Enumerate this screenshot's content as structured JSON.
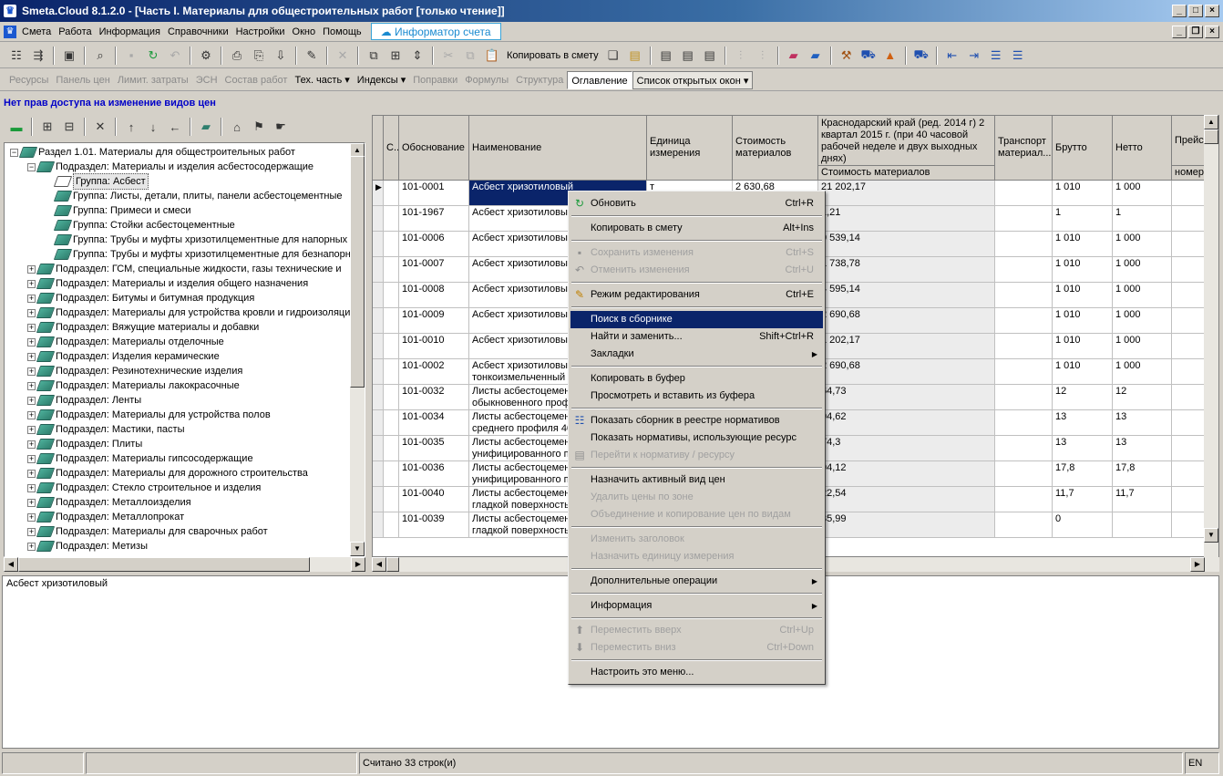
{
  "window": {
    "title": "Smeta.Cloud  8.1.2.0  - [Часть I. Материалы для общестроительных работ  [только чтение]]"
  },
  "menu": {
    "items": [
      "Смета",
      "Работа",
      "Информация",
      "Справочники",
      "Настройки",
      "Окно",
      "Помощь"
    ],
    "informator": "Информатор счета"
  },
  "toolbar1": {
    "copy_to_estimate": "Копировать в смету"
  },
  "toolbar2": {
    "items": [
      "Ресурсы",
      "Панель цен",
      "Лимит. затраты",
      "ЭСН",
      "Состав работ",
      "Тех. часть",
      "Индексы",
      "Поправки",
      "Формулы",
      "Структура",
      "Оглавление",
      "Список открытых окон"
    ]
  },
  "notice": "Нет прав доступа на изменение видов цен",
  "tree": {
    "nodes": [
      {
        "label": "Раздел 1.01. Материалы для общестроительных работ",
        "level": 0,
        "exp": "−"
      },
      {
        "label": "Подраздел: Материалы и изделия асбестосодержащие",
        "level": 1,
        "exp": "−"
      },
      {
        "label": "Группа: Асбест",
        "level": 2,
        "exp": "",
        "selected": true
      },
      {
        "label": "Группа: Листы, детали, плиты, панели асбестоцементные",
        "level": 2,
        "exp": ""
      },
      {
        "label": "Группа: Примеси и смеси",
        "level": 2,
        "exp": ""
      },
      {
        "label": "Группа: Стойки асбестоцементные",
        "level": 2,
        "exp": ""
      },
      {
        "label": "Группа: Трубы и муфты хризотилцементные для напорных",
        "level": 2,
        "exp": ""
      },
      {
        "label": "Группа: Трубы и муфты хризотилцементные для безнапорн",
        "level": 2,
        "exp": ""
      },
      {
        "label": "Подраздел: ГСМ, специальные жидкости, газы технические и",
        "level": 1,
        "exp": "+"
      },
      {
        "label": "Подраздел: Материалы и изделия общего назначения",
        "level": 1,
        "exp": "+"
      },
      {
        "label": "Подраздел: Битумы и битумная продукция",
        "level": 1,
        "exp": "+"
      },
      {
        "label": "Подраздел: Материалы для устройства кровли и гидроизоляци",
        "level": 1,
        "exp": "+"
      },
      {
        "label": "Подраздел: Вяжущие материалы и добавки",
        "level": 1,
        "exp": "+"
      },
      {
        "label": "Подраздел: Материалы отделочные",
        "level": 1,
        "exp": "+"
      },
      {
        "label": "Подраздел: Изделия керамические",
        "level": 1,
        "exp": "+"
      },
      {
        "label": "Подраздел: Резинотехнические изделия",
        "level": 1,
        "exp": "+"
      },
      {
        "label": "Подраздел: Материалы лакокрасочные",
        "level": 1,
        "exp": "+"
      },
      {
        "label": "Подраздел: Ленты",
        "level": 1,
        "exp": "+"
      },
      {
        "label": "Подраздел: Материалы для устройства полов",
        "level": 1,
        "exp": "+"
      },
      {
        "label": "Подраздел: Мастики, пасты",
        "level": 1,
        "exp": "+"
      },
      {
        "label": "Подраздел: Плиты",
        "level": 1,
        "exp": "+"
      },
      {
        "label": "Подраздел: Материалы гипсосодержащие",
        "level": 1,
        "exp": "+"
      },
      {
        "label": "Подраздел: Материалы для дорожного строительства",
        "level": 1,
        "exp": "+"
      },
      {
        "label": "Подраздел: Стекло строительное и изделия",
        "level": 1,
        "exp": "+"
      },
      {
        "label": "Подраздел: Металлоизделия",
        "level": 1,
        "exp": "+"
      },
      {
        "label": "Подраздел: Металлопрокат",
        "level": 1,
        "exp": "+"
      },
      {
        "label": "Подраздел: Материалы для сварочных работ",
        "level": 1,
        "exp": "+"
      },
      {
        "label": "Подраздел: Метизы",
        "level": 1,
        "exp": "+"
      }
    ]
  },
  "grid": {
    "headers": {
      "c": "С..",
      "code": "Обоснование",
      "name": "Наименование",
      "unit": "Единица измерения",
      "cost": "Стоимость материалов",
      "region": "Краснодарский край (ред. 2014 г) 2 квартал 2015 г. (при 40 часовой рабочей неделе и двух выходных днях)",
      "region_sub": "Стоимость материалов",
      "transport": "Транспорт материал...",
      "brutto": "Брутто",
      "netto": "Нетто",
      "price": "Прейс...",
      "price_sub": "номер"
    },
    "rows": [
      {
        "code": "101-0001",
        "name": "Асбест хризотиловый",
        "name2": "",
        "unit": "т",
        "cost": "2 630,68",
        "region": "21 202,17",
        "brutto": "1 010",
        "netto": "1 000"
      },
      {
        "code": "101-1967",
        "name": "Асбест хризотиловый",
        "name2": "",
        "unit": "",
        "cost": "",
        "region": "1,21",
        "brutto": "1",
        "netto": "1"
      },
      {
        "code": "101-0006",
        "name": "Асбест хризотиловый",
        "name2": "",
        "unit": "",
        "cost": "",
        "region": "9 539,14",
        "brutto": "1 010",
        "netto": "1 000"
      },
      {
        "code": "101-0007",
        "name": "Асбест хризотиловый",
        "name2": "",
        "unit": "",
        "cost": "",
        "region": "1 738,78",
        "brutto": "1 010",
        "netto": "1 000"
      },
      {
        "code": "101-0008",
        "name": "Асбест хризотиловый",
        "name2": "",
        "unit": "",
        "cost": "",
        "region": "4 595,14",
        "brutto": "1 010",
        "netto": "1 000"
      },
      {
        "code": "101-0009",
        "name": "Асбест хризотиловый",
        "name2": "",
        "unit": "",
        "cost": "",
        "region": "2 690,68",
        "brutto": "1 010",
        "netto": "1 000"
      },
      {
        "code": "101-0010",
        "name": "Асбест хризотиловый",
        "name2": "",
        "unit": "",
        "cost": "",
        "region": "1 202,17",
        "brutto": "1 010",
        "netto": "1 000"
      },
      {
        "code": "101-0002",
        "name": "Асбест хризотиловый",
        "name2": "тонкоизмельченный",
        "unit": "",
        "cost": "",
        "region": "2 690,68",
        "brutto": "1 010",
        "netto": "1 000"
      },
      {
        "code": "101-0032",
        "name": "Листы асбестоцемен",
        "name2": "обыкновенного проф",
        "unit": "",
        "cost": "",
        "region": "64,73",
        "brutto": "12",
        "netto": "12"
      },
      {
        "code": "101-0034",
        "name": "Листы асбестоцемен",
        "name2": "среднего профиля 40",
        "unit": "",
        "cost": "",
        "region": "94,62",
        "brutto": "13",
        "netto": "13"
      },
      {
        "code": "101-0035",
        "name": "Листы асбестоцемен",
        "name2": "унифицированного пр",
        "unit": "",
        "cost": "",
        "region": "74,3",
        "brutto": "13",
        "netto": "13"
      },
      {
        "code": "101-0036",
        "name": "Листы асбестоцемен",
        "name2": "унифицированного пр",
        "unit": "",
        "cost": "",
        "region": "94,12",
        "brutto": "17,8",
        "netto": "17,8"
      },
      {
        "code": "101-0040",
        "name": "Листы асбестоцемен",
        "name2": "гладкой поверхность",
        "unit": "",
        "cost": "",
        "region": "22,54",
        "brutto": "11,7",
        "netto": "11,7"
      },
      {
        "code": "101-0039",
        "name": "Листы асбестоцемен",
        "name2": "гладкой поверхность",
        "unit": "",
        "cost": "",
        "region": "35,99",
        "brutto": "0",
        "netto": ""
      }
    ]
  },
  "description": "Асбест хризотиловый",
  "status": {
    "count": "Считано 33 строк(и)",
    "lang": "EN"
  },
  "context_menu": {
    "items": [
      {
        "type": "item",
        "label": "Обновить",
        "shortcut": "Ctrl+R",
        "icon": "refresh",
        "disabled": false
      },
      {
        "type": "sep"
      },
      {
        "type": "item",
        "label": "Копировать в смету",
        "shortcut": "Alt+Ins",
        "disabled": false
      },
      {
        "type": "sep"
      },
      {
        "type": "item",
        "label": "Сохранить изменения",
        "shortcut": "Ctrl+S",
        "icon": "save",
        "disabled": true
      },
      {
        "type": "item",
        "label": "Отменить изменения",
        "shortcut": "Ctrl+U",
        "icon": "undo",
        "disabled": true
      },
      {
        "type": "sep"
      },
      {
        "type": "item",
        "label": "Режим редактирования",
        "shortcut": "Ctrl+E",
        "icon": "edit",
        "disabled": false
      },
      {
        "type": "sep"
      },
      {
        "type": "item",
        "label": "Поиск в сборнике",
        "shortcut": "",
        "disabled": false,
        "highlight": true
      },
      {
        "type": "item",
        "label": "Найти и заменить...",
        "shortcut": "Shift+Ctrl+R",
        "disabled": false
      },
      {
        "type": "item",
        "label": "Закладки",
        "shortcut": "",
        "disabled": false,
        "submenu": true
      },
      {
        "type": "sep"
      },
      {
        "type": "item",
        "label": "Копировать в буфер",
        "shortcut": "",
        "disabled": false
      },
      {
        "type": "item",
        "label": "Просмотреть и вставить из буфера",
        "shortcut": "",
        "disabled": false
      },
      {
        "type": "sep"
      },
      {
        "type": "item",
        "label": "Показать сборник в реестре нормативов",
        "shortcut": "",
        "icon": "registry",
        "disabled": false
      },
      {
        "type": "item",
        "label": "Показать нормативы, использующие ресурс",
        "shortcut": "",
        "disabled": false
      },
      {
        "type": "item",
        "label": "Перейти к нормативу / ресурсу",
        "shortcut": "",
        "icon": "goto",
        "disabled": true
      },
      {
        "type": "sep"
      },
      {
        "type": "item",
        "label": "Назначить активный вид цен",
        "shortcut": "",
        "disabled": false
      },
      {
        "type": "item",
        "label": "Удалить цены по зоне",
        "shortcut": "",
        "disabled": true
      },
      {
        "type": "item",
        "label": "Объединение и копирование цен по видам",
        "shortcut": "",
        "disabled": true
      },
      {
        "type": "sep"
      },
      {
        "type": "item",
        "label": "Изменить заголовок",
        "shortcut": "",
        "disabled": true
      },
      {
        "type": "item",
        "label": "Назначить единицу измерения",
        "shortcut": "",
        "disabled": true
      },
      {
        "type": "sep"
      },
      {
        "type": "item",
        "label": "Дополнительные операции",
        "shortcut": "",
        "disabled": false,
        "submenu": true
      },
      {
        "type": "sep"
      },
      {
        "type": "item",
        "label": "Информация",
        "shortcut": "",
        "disabled": false,
        "submenu": true
      },
      {
        "type": "sep"
      },
      {
        "type": "item",
        "label": "Переместить вверх",
        "shortcut": "Ctrl+Up",
        "icon": "up",
        "disabled": true
      },
      {
        "type": "item",
        "label": "Переместить вниз",
        "shortcut": "Ctrl+Down",
        "icon": "down",
        "disabled": true
      },
      {
        "type": "sep"
      },
      {
        "type": "item",
        "label": "Настроить это меню...",
        "shortcut": "",
        "disabled": false
      }
    ]
  }
}
